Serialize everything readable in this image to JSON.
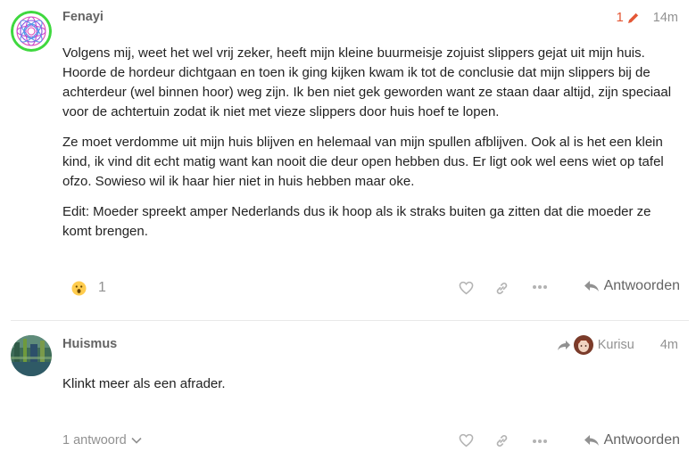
{
  "posts": [
    {
      "username": "Fenayi",
      "edit_count": "1",
      "time": "14m",
      "paragraphs": [
        "Volgens mij, weet het wel vrij zeker, heeft mijn kleine buurmeisje zojuist slippers gejat uit mijn huis. Hoorde de hordeur dichtgaan en toen ik ging kijken kwam ik tot de conclusie dat mijn slippers bij de achterdeur (wel binnen hoor) weg zijn. Ik ben niet gek geworden want ze staan daar altijd, zijn speciaal voor de achtertuin zodat ik niet met vieze slippers door huis hoef te lopen.",
        "Ze moet verdomme uit mijn huis blijven en helemaal van mijn spullen afblijven. Ook al is het een klein kind, ik vind dit echt matig want kan nooit die deur open hebben dus. Er ligt ook wel eens wiet op tafel ofzo. Sowieso wil ik haar hier niet in huis hebben maar oke.",
        "Edit: Moeder spreekt amper Nederlands dus ik hoop als ik straks buiten ga zitten dat die moeder ze komt brengen."
      ],
      "reaction_count": "1",
      "reply_label": "Antwoorden"
    },
    {
      "username": "Huismus",
      "reply_to_user": "Kurisu",
      "time": "4m",
      "paragraphs": [
        "Klinkt meer als een afrader."
      ],
      "replies_label": "1 antwoord",
      "reply_label": "Antwoorden"
    }
  ],
  "colors": {
    "edit_accent": "#e45735",
    "muted": "#919191",
    "avatar_ring": "#3fd83f"
  },
  "icons": [
    "heart-icon",
    "link-icon",
    "more-icon",
    "reply-icon",
    "pencil-icon",
    "share-arrow-icon",
    "chevron-down-icon",
    "surprised-emoji-icon"
  ]
}
